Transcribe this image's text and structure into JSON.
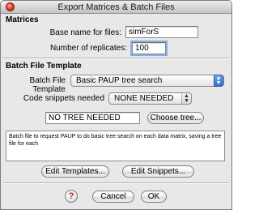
{
  "window": {
    "title": "Export Matrices & Batch Files"
  },
  "matrices": {
    "heading": "Matrices",
    "base_name_label": "Base name for files:",
    "base_name_value": "simForS",
    "replicates_label": "Number of replicates:",
    "replicates_value": "100"
  },
  "batch": {
    "heading": "Batch File Template",
    "template_label": "Batch File Template",
    "template_value": "Basic PAUP tree search",
    "snippets_label": "Code snippets needed",
    "snippets_value": "NONE NEEDED",
    "tree_value": "NO TREE NEEDED",
    "choose_tree_label": "Choose tree...",
    "description": "Batch file to request PAUP to do basic tree search on each data matrix, saving a tree file for each",
    "edit_templates_label": "Edit Templates...",
    "edit_snippets_label": "Edit Snippets..."
  },
  "footer": {
    "help_label": "?",
    "cancel_label": "Cancel",
    "ok_label": "OK"
  },
  "icons": {
    "close": "close-icon",
    "help": "help-icon",
    "popup": "chevron-updown-icon"
  },
  "colors": {
    "popup_accent": "#2f6fd1",
    "help_question": "#c11b1b"
  }
}
